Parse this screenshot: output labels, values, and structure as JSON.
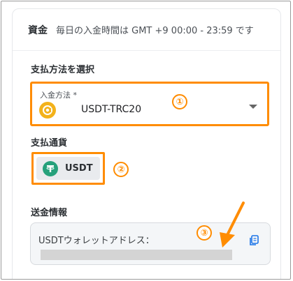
{
  "header": {
    "title": "資金",
    "hours": "毎日の入金時間は GMT +9 00:00 - 23:59 です"
  },
  "payment": {
    "section_label": "支払方法を選択",
    "select_caption": "入金方法 *",
    "select_value": "USDT-TRC20",
    "icon": "coin-icon"
  },
  "currency": {
    "section_label": "支払通貨",
    "value": "USDT",
    "icon": "tether-icon"
  },
  "remittance": {
    "section_label": "送金情報",
    "address_label": "USDTウォレットアドレス：",
    "address_value_hidden": true,
    "copy_icon": "copy-icon"
  },
  "annotations": {
    "marker_1": "①",
    "marker_2": "②",
    "marker_3": "③",
    "color": "#ff8c00"
  }
}
